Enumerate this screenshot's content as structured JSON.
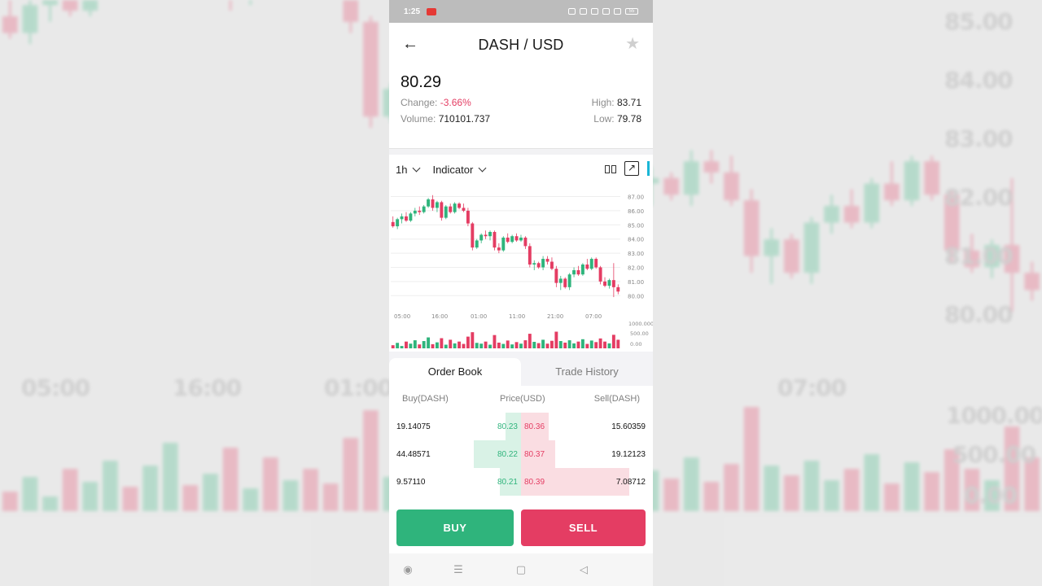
{
  "app": {
    "pair_title": "DASH / USD",
    "price": "80.29",
    "stats": {
      "change_label": "Change:",
      "change_value": "-3.66%",
      "high_label": "High:",
      "high_value": "83.71",
      "volume_label": "Volume:",
      "volume_value": "710101.737",
      "low_label": "Low:",
      "low_value": "79.78"
    },
    "chart_controls": {
      "interval": "1h",
      "indicator": "Indicator"
    }
  },
  "status_bar": {
    "time": "1:25",
    "battery": "55"
  },
  "tabs": {
    "order_book": "Order Book",
    "trade_history": "Trade History"
  },
  "order_book": {
    "headers": {
      "buy": "Buy(DASH)",
      "price": "Price(USD)",
      "sell": "Sell(DASH)"
    },
    "rows": [
      {
        "buy": "19.14075",
        "bid": "80.23",
        "ask": "80.36",
        "sell": "15.60359",
        "bid_depth": 0.12,
        "ask_depth": 0.21
      },
      {
        "buy": "44.48571",
        "bid": "80.22",
        "ask": "80.37",
        "sell": "19.12123",
        "bid_depth": 0.36,
        "ask_depth": 0.26
      },
      {
        "buy": "9.57110",
        "bid": "80.21",
        "ask": "80.39",
        "sell": "7.08712",
        "bid_depth": 0.16,
        "ask_depth": 0.82
      }
    ]
  },
  "buttons": {
    "buy": "BUY",
    "sell": "SELL"
  },
  "background": {
    "price_labels": [
      "85.00",
      "84.00",
      "83.00",
      "82.00",
      "81.00",
      "80.00"
    ],
    "time_labels": [
      "05:00",
      "16:00",
      "01:00",
      "07:00"
    ],
    "volume_labels": [
      "1000.000",
      "500.00",
      "0.00"
    ]
  },
  "chart_data": {
    "type": "candlestick",
    "price_axis_labels": [
      "87.00",
      "86.00",
      "85.00",
      "84.00",
      "83.00",
      "82.00",
      "81.00",
      "80.00"
    ],
    "time_axis_labels": [
      "05:00",
      "16:00",
      "01:00",
      "11:00",
      "21:00",
      "07:00"
    ],
    "volume_axis_labels": [
      "1000.000",
      "500.00",
      "0.00"
    ],
    "ylim": [
      79.5,
      87.2
    ],
    "colors": {
      "up": "#2fb47c",
      "down": "#e43d63"
    },
    "candles": [
      [
        85.2,
        85.6,
        84.8,
        84.9
      ],
      [
        84.9,
        85.5,
        84.7,
        85.4
      ],
      [
        85.4,
        85.8,
        85.1,
        85.6
      ],
      [
        85.6,
        85.9,
        85.2,
        85.3
      ],
      [
        85.3,
        85.9,
        85.2,
        85.8
      ],
      [
        85.8,
        86.2,
        85.6,
        86.0
      ],
      [
        86.0,
        86.3,
        85.7,
        85.9
      ],
      [
        85.9,
        86.4,
        85.8,
        86.3
      ],
      [
        86.3,
        86.9,
        86.2,
        86.8
      ],
      [
        86.8,
        87.1,
        86.0,
        86.2
      ],
      [
        86.2,
        86.7,
        85.9,
        86.6
      ],
      [
        86.6,
        86.7,
        85.3,
        85.5
      ],
      [
        85.5,
        86.4,
        85.4,
        86.3
      ],
      [
        86.3,
        86.5,
        85.8,
        85.9
      ],
      [
        85.9,
        86.6,
        85.8,
        86.5
      ],
      [
        86.5,
        86.6,
        86.1,
        86.2
      ],
      [
        86.2,
        86.5,
        85.9,
        86.0
      ],
      [
        86.0,
        86.2,
        84.9,
        85.1
      ],
      [
        85.1,
        85.2,
        83.2,
        83.4
      ],
      [
        83.4,
        84.0,
        83.3,
        83.9
      ],
      [
        83.9,
        84.4,
        83.7,
        84.3
      ],
      [
        84.3,
        84.6,
        84.0,
        84.2
      ],
      [
        84.2,
        84.6,
        83.9,
        84.5
      ],
      [
        84.5,
        84.6,
        83.2,
        83.4
      ],
      [
        83.4,
        83.7,
        83.0,
        83.2
      ],
      [
        83.2,
        84.2,
        83.1,
        84.1
      ],
      [
        84.1,
        84.4,
        83.7,
        83.8
      ],
      [
        83.8,
        84.3,
        83.7,
        84.2
      ],
      [
        84.2,
        84.4,
        83.8,
        83.9
      ],
      [
        83.9,
        84.3,
        83.8,
        84.1
      ],
      [
        84.1,
        84.2,
        83.3,
        83.5
      ],
      [
        83.5,
        83.7,
        82.0,
        82.2
      ],
      [
        82.2,
        82.5,
        81.8,
        82.3
      ],
      [
        82.3,
        82.4,
        81.9,
        82.0
      ],
      [
        82.0,
        82.8,
        81.8,
        82.6
      ],
      [
        82.6,
        82.8,
        82.2,
        82.4
      ],
      [
        82.4,
        82.7,
        81.8,
        81.9
      ],
      [
        81.9,
        82.1,
        80.6,
        80.9
      ],
      [
        80.9,
        81.4,
        80.4,
        81.2
      ],
      [
        81.2,
        81.3,
        80.5,
        80.6
      ],
      [
        80.6,
        81.6,
        80.4,
        81.5
      ],
      [
        81.5,
        82.0,
        81.3,
        81.8
      ],
      [
        81.8,
        82.1,
        81.4,
        81.5
      ],
      [
        81.5,
        82.3,
        81.4,
        82.2
      ],
      [
        82.2,
        82.6,
        81.8,
        81.9
      ],
      [
        81.9,
        82.7,
        81.8,
        82.6
      ],
      [
        82.6,
        82.7,
        81.9,
        82.0
      ],
      [
        82.0,
        82.1,
        80.8,
        81.0
      ],
      [
        81.0,
        81.3,
        80.6,
        80.7
      ],
      [
        80.7,
        81.2,
        80.5,
        81.1
      ],
      [
        81.1,
        82.3,
        79.9,
        80.6
      ],
      [
        80.6,
        80.8,
        80.1,
        80.29
      ]
    ],
    "volumes": [
      120,
      210,
      90,
      260,
      180,
      310,
      150,
      280,
      420,
      160,
      230,
      390,
      140,
      330,
      190,
      260,
      170,
      450,
      620,
      210,
      180,
      260,
      140,
      510,
      220,
      170,
      300,
      150,
      240,
      180,
      310,
      560,
      250,
      200,
      330,
      180,
      290,
      640,
      280,
      220,
      310,
      190,
      260,
      350,
      170,
      300,
      240,
      380,
      260,
      190,
      520,
      330
    ]
  }
}
